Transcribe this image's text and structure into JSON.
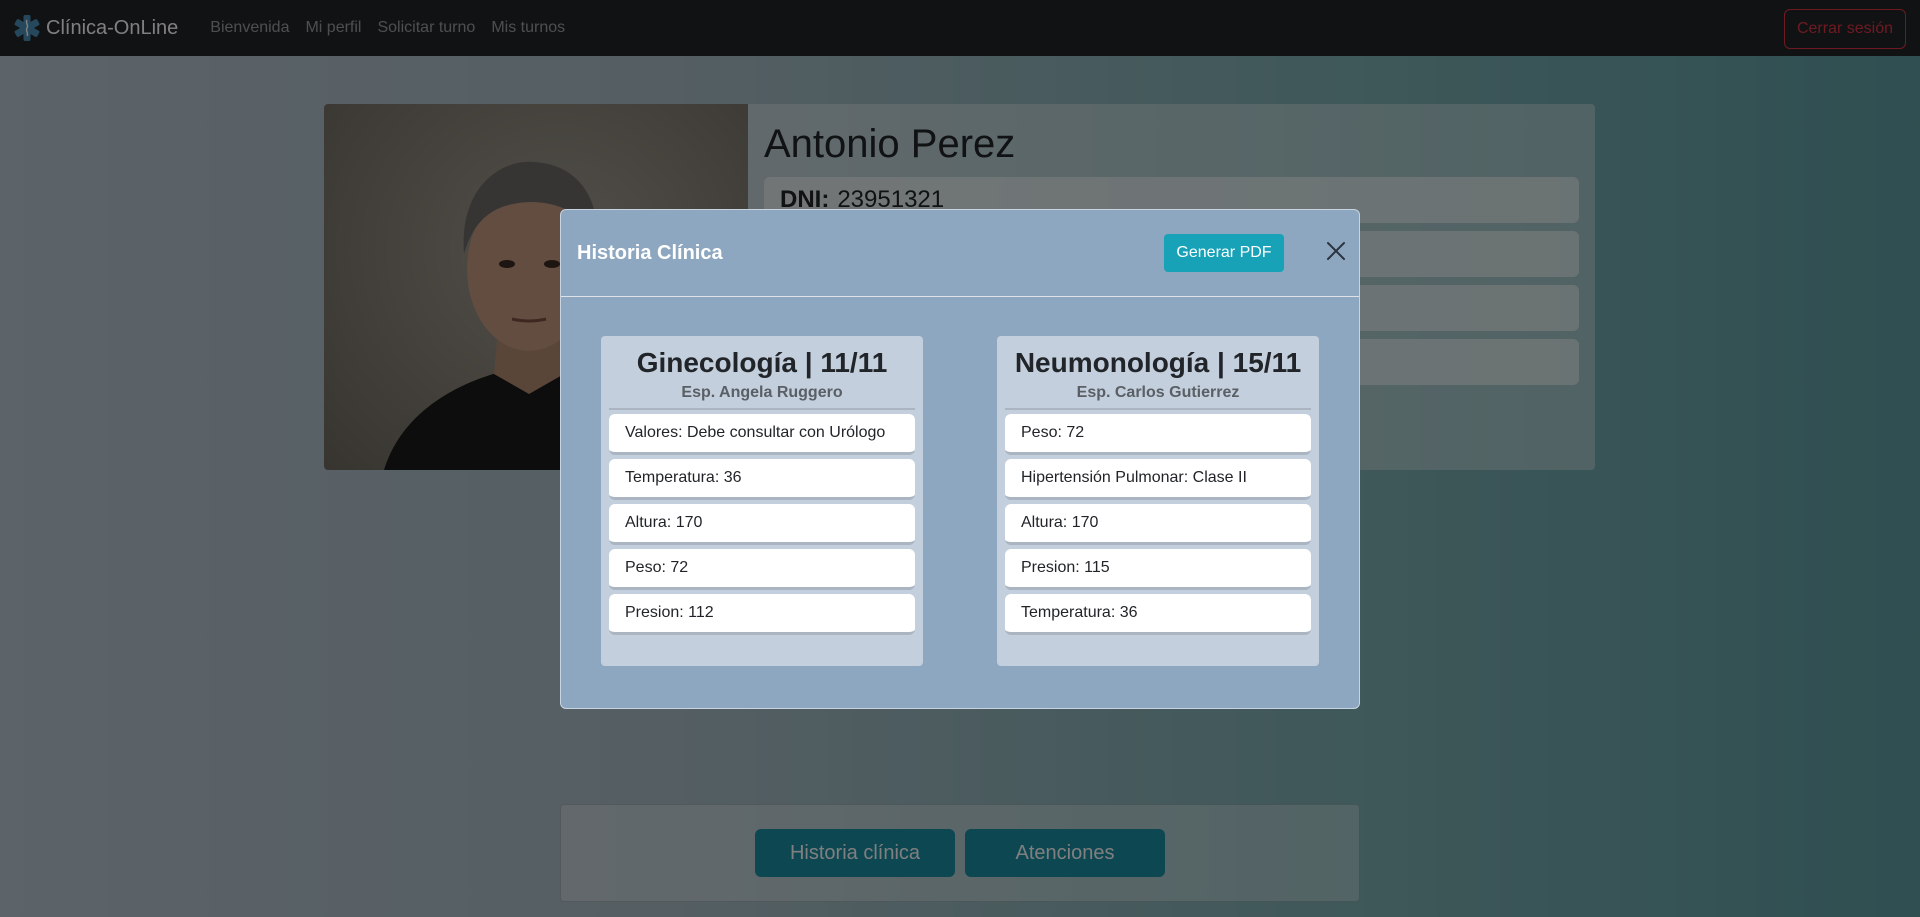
{
  "navbar": {
    "brand": "Clínica-OnLine",
    "links": [
      "Bienvenida",
      "Mi perfil",
      "Solicitar turno",
      "Mis turnos"
    ],
    "logout": "Cerrar sesión"
  },
  "profile": {
    "name": "Antonio Perez",
    "dni_label": "DNI:",
    "dni_value": "23951321"
  },
  "bottom": {
    "historia_btn": "Historia clínica",
    "atenciones_btn": "Atenciones"
  },
  "modal": {
    "title": "Historia Clínica",
    "pdf_btn": "Generar PDF",
    "records": [
      {
        "title": "Ginecología | 11/11",
        "specialist": "Esp. Angela Ruggero",
        "items": [
          "Valores: Debe consultar con Urólogo",
          "Temperatura: 36",
          "Altura: 170",
          "Peso: 72",
          "Presion: 112"
        ]
      },
      {
        "title": "Neumonología | 15/11",
        "specialist": "Esp. Carlos Gutierrez",
        "items": [
          "Peso: 72",
          "Hipertensión Pulmonar: Clase II",
          "Altura: 170",
          "Presion: 115",
          "Temperatura: 36"
        ]
      }
    ]
  },
  "colors": {
    "navbar": "#212529",
    "accent": "#17a2b8",
    "danger": "#dc3545",
    "modal_bg": "#8ea7c0"
  }
}
